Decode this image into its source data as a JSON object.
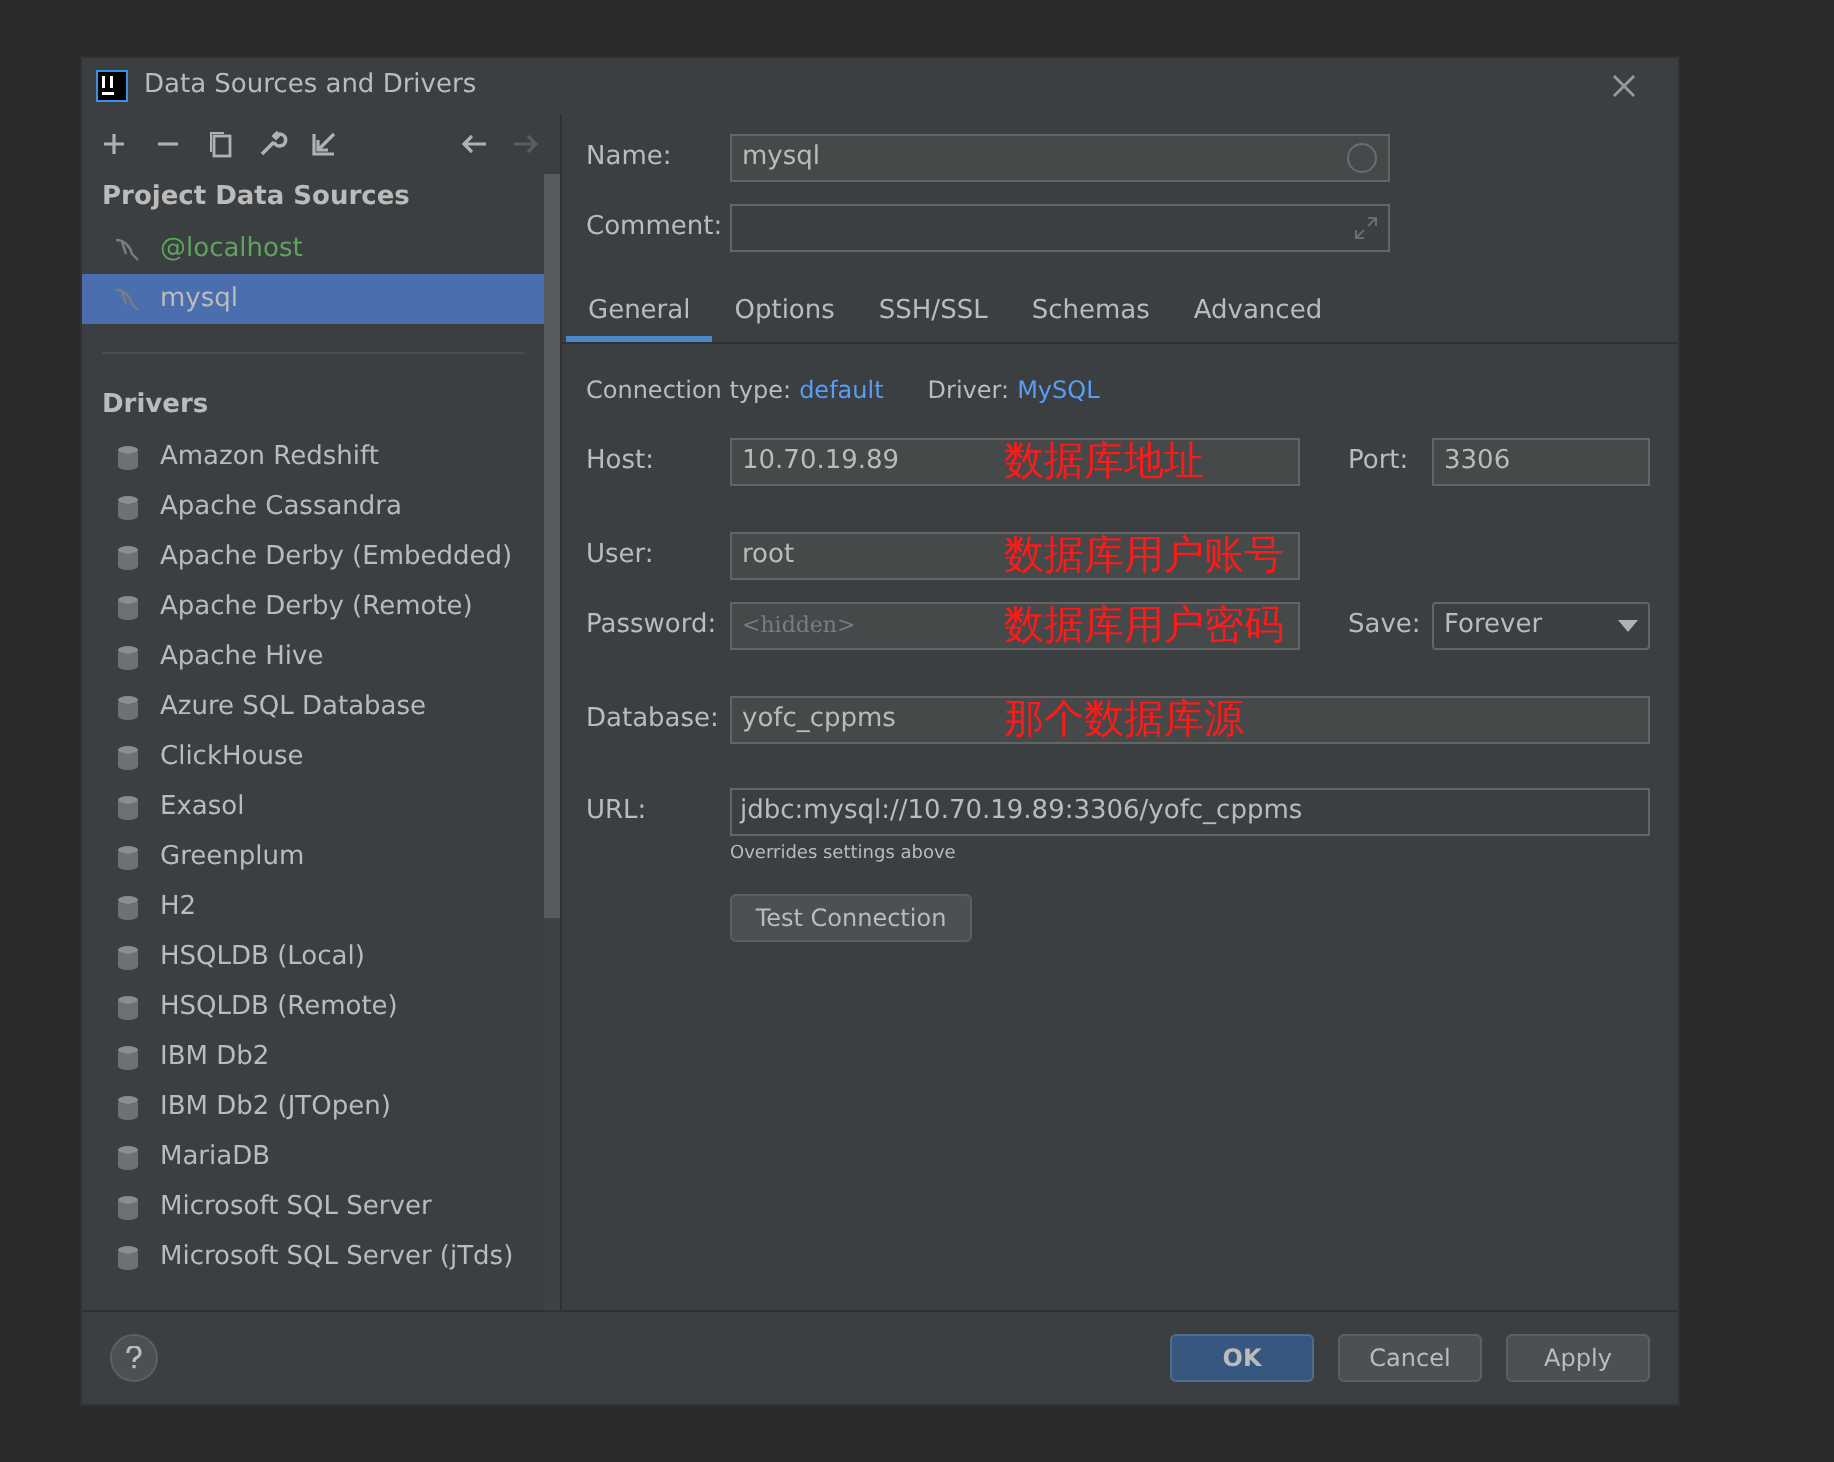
{
  "window": {
    "title": "Data Sources and Drivers"
  },
  "sidebar": {
    "section_title": "Project Data Sources",
    "data_sources": [
      {
        "label": "@localhost",
        "selected": false,
        "color": "#5fa35f"
      },
      {
        "label": "mysql",
        "selected": true,
        "color": "#bbbbbb"
      }
    ],
    "drivers_title": "Drivers",
    "drivers": [
      "Amazon Redshift",
      "Apache Cassandra",
      "Apache Derby (Embedded)",
      "Apache Derby (Remote)",
      "Apache Hive",
      "Azure SQL Database",
      "ClickHouse",
      "Exasol",
      "Greenplum",
      "H2",
      "HSQLDB (Local)",
      "HSQLDB (Remote)",
      "IBM Db2",
      "IBM Db2 (JTOpen)",
      "MariaDB",
      "Microsoft SQL Server",
      "Microsoft SQL Server (jTds)"
    ]
  },
  "name": {
    "label": "Name:",
    "value": "mysql"
  },
  "comment": {
    "label": "Comment:"
  },
  "tabs": [
    {
      "label": "General",
      "selected": true
    },
    {
      "label": "Options",
      "selected": false
    },
    {
      "label": "SSH/SSL",
      "selected": false
    },
    {
      "label": "Schemas",
      "selected": false
    },
    {
      "label": "Advanced",
      "selected": false
    }
  ],
  "connection_type": {
    "label": "Connection type:",
    "value": "default"
  },
  "driver": {
    "label": "Driver:",
    "value": "MySQL"
  },
  "host": {
    "label": "Host:",
    "value": "10.70.19.89",
    "annotation": "数据库地址"
  },
  "port": {
    "label": "Port:",
    "value": "3306"
  },
  "user": {
    "label": "User:",
    "value": "root",
    "annotation": "数据库用户账号"
  },
  "password": {
    "label": "Password:",
    "placeholder": "<hidden>",
    "annotation": "数据库用户密码"
  },
  "save": {
    "label": "Save:",
    "value": "Forever"
  },
  "database": {
    "label": "Database:",
    "value": "yofc_cppms",
    "annotation": "那个数据库源"
  },
  "url": {
    "label": "URL:",
    "value": "jdbc:mysql://10.70.19.89:3306/yofc_cppms",
    "hint": "Overrides settings above"
  },
  "test_button": "Test Connection",
  "buttons": [
    {
      "label": "OK",
      "kind": "primary"
    },
    {
      "label": "Cancel",
      "kind": "normal"
    },
    {
      "label": "Apply",
      "kind": "normal"
    }
  ]
}
